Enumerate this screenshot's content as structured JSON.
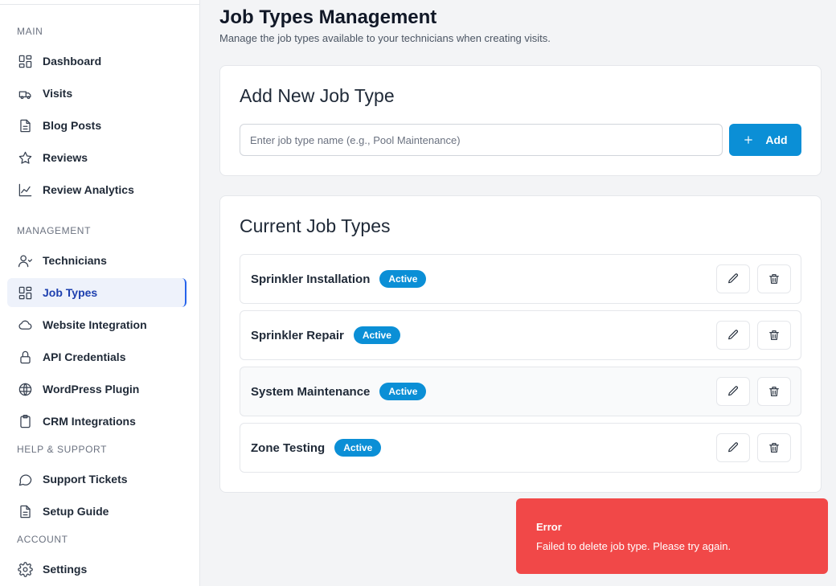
{
  "sidebar": {
    "sections": {
      "main": "MAIN",
      "management": "MANAGEMENT",
      "help": "HELP & SUPPORT",
      "account": "ACCOUNT"
    },
    "items": {
      "dashboard": "Dashboard",
      "visits": "Visits",
      "blog_posts": "Blog Posts",
      "reviews": "Reviews",
      "review_analytics": "Review Analytics",
      "technicians": "Technicians",
      "job_types": "Job Types",
      "website_integration": "Website Integration",
      "api_credentials": "API Credentials",
      "wordpress_plugin": "WordPress Plugin",
      "crm_integrations": "CRM Integrations",
      "support_tickets": "Support Tickets",
      "setup_guide": "Setup Guide",
      "settings": "Settings"
    },
    "active": "job_types"
  },
  "header": {
    "title": "Job Types Management",
    "subtitle": "Manage the job types available to your technicians when creating visits."
  },
  "add_card": {
    "title": "Add New Job Type",
    "input_placeholder": "Enter job type name (e.g., Pool Maintenance)",
    "input_value": "",
    "button_label": "Add"
  },
  "list_card": {
    "title": "Current Job Types",
    "rows": [
      {
        "name": "Sprinkler Installation",
        "status": "Active"
      },
      {
        "name": "Sprinkler Repair",
        "status": "Active"
      },
      {
        "name": "System Maintenance",
        "status": "Active"
      },
      {
        "name": "Zone Testing",
        "status": "Active"
      }
    ]
  },
  "toast": {
    "title": "Error",
    "message": "Failed to delete job type. Please try again."
  },
  "colors": {
    "accent": "#0b8fd6",
    "error": "#f14848",
    "active_nav_bg": "#eef2fb",
    "active_nav_text": "#1e40af"
  },
  "icons": {
    "edit": "pencil-icon",
    "delete": "trash-icon",
    "add": "plus-icon"
  }
}
